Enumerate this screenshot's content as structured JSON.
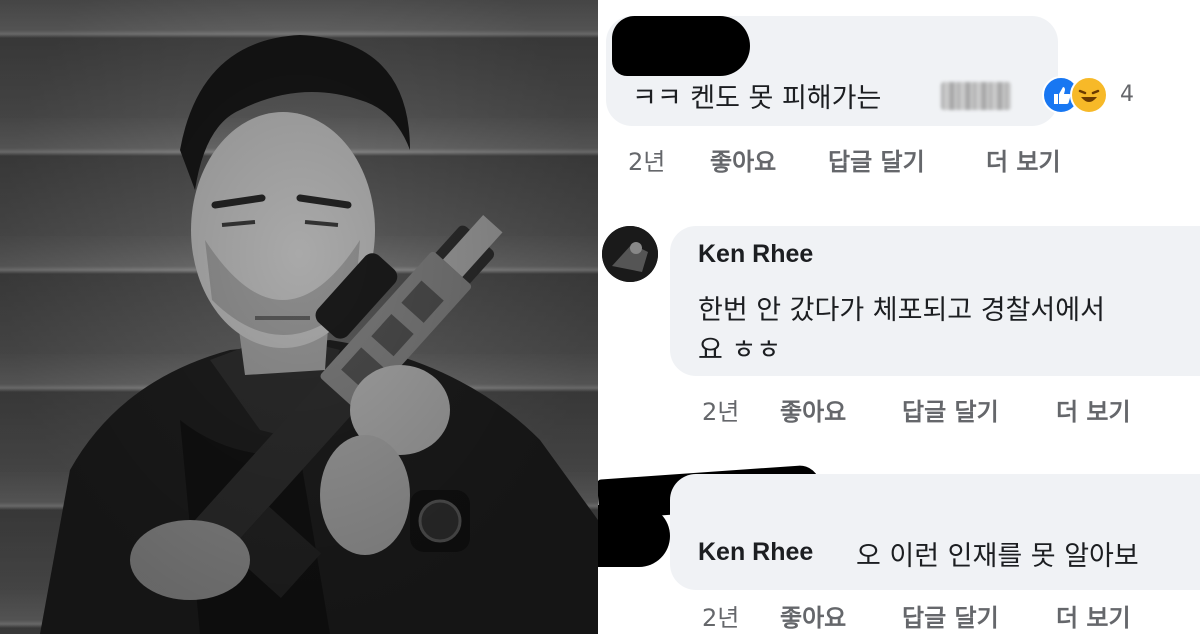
{
  "comments": [
    {
      "text": "ㅋㅋ 켄도 못 피해가는",
      "reactions": {
        "icons": [
          "like-icon",
          "haha-icon"
        ],
        "count": "4"
      },
      "actions": {
        "time": "2년",
        "like": "좋아요",
        "reply": "답글 달기",
        "more": "더 보기"
      }
    },
    {
      "author": "Ken Rhee",
      "text_line1": "한번 안 갔다가 체포되고 경찰서에서",
      "text_line2": "요 ㅎㅎ",
      "actions": {
        "time": "2년",
        "like": "좋아요",
        "reply": "답글 달기",
        "more": "더 보기"
      }
    },
    {
      "author": "Ken Rhee",
      "text": "오 이런 인재를 못 알아보",
      "actions": {
        "time": "2년",
        "like": "좋아요",
        "reply": "답글 달기",
        "more": "더 보기"
      }
    }
  ],
  "colors": {
    "bubble": "#f0f2f5",
    "meta_text": "#65676b",
    "like_blue": "#1877f2",
    "haha_yellow": "#f7b928"
  }
}
